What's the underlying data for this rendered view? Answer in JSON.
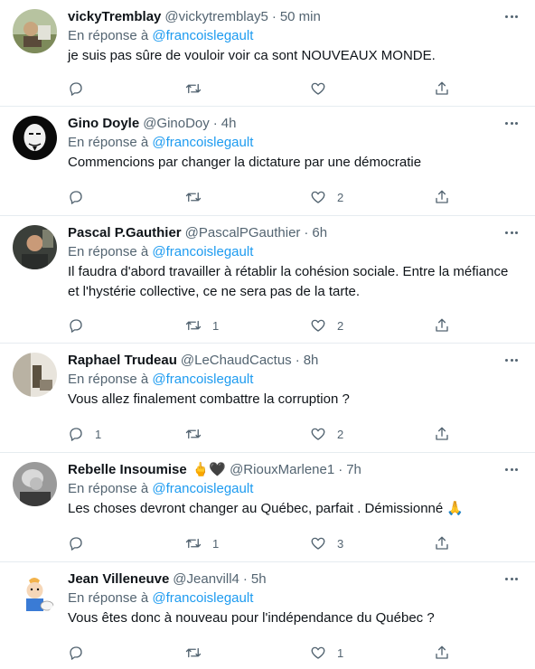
{
  "colors": {
    "link": "#1d9bf0",
    "muted": "#536471",
    "text": "#0f1419",
    "divider": "#e6ecf0"
  },
  "reply_prefix": "En réponse à",
  "reply_target": "@francoislegault",
  "tweets": [
    {
      "name": "vickyTremblay",
      "name_emoji": "",
      "handle": "@vickytremblay5",
      "time": "50 min",
      "text_lines": [
        "je suis pas sûre  de vouloir  voir ca sont NOUVEAUX  MONDE."
      ],
      "replies": "",
      "retweets": "",
      "likes": ""
    },
    {
      "name": "Gino Doyle",
      "name_emoji": "",
      "handle": "@GinoDoy",
      "time": "4h",
      "text_lines": [
        "Commencions par changer la dictature par une démocratie"
      ],
      "replies": "",
      "retweets": "",
      "likes": "2"
    },
    {
      "name": "Pascal P.Gauthier",
      "name_emoji": "",
      "handle": "@PascalPGauthier",
      "time": "6h",
      "text_lines": [
        "Il faudra d'abord travailler à rétablir la cohésion sociale. Entre la méfiance",
        "et l'hystérie collective, ce ne sera pas de la tarte."
      ],
      "replies": "",
      "retweets": "1",
      "likes": "2"
    },
    {
      "name": "Raphael Trudeau",
      "name_emoji": "",
      "handle": "@LeChaudCactus",
      "time": "8h",
      "text_lines": [
        "Vous allez finalement combattre la corruption ?"
      ],
      "replies": "1",
      "retweets": "",
      "likes": "2"
    },
    {
      "name": "Rebelle Insoumise",
      "name_emoji": "🖕🖤",
      "handle": "@RiouxMarlene1",
      "time": "7h",
      "text_lines": [
        "Les choses devront changer au Québec, parfait . Démissionné 🙏"
      ],
      "replies": "",
      "retweets": "1",
      "likes": "3"
    },
    {
      "name": "Jean Villeneuve",
      "name_emoji": "",
      "handle": "@Jeanvill4",
      "time": "5h",
      "text_lines": [
        "Vous êtes donc à nouveau pour l'indépendance du Québec ?"
      ],
      "replies": "",
      "retweets": "",
      "likes": "1"
    }
  ]
}
